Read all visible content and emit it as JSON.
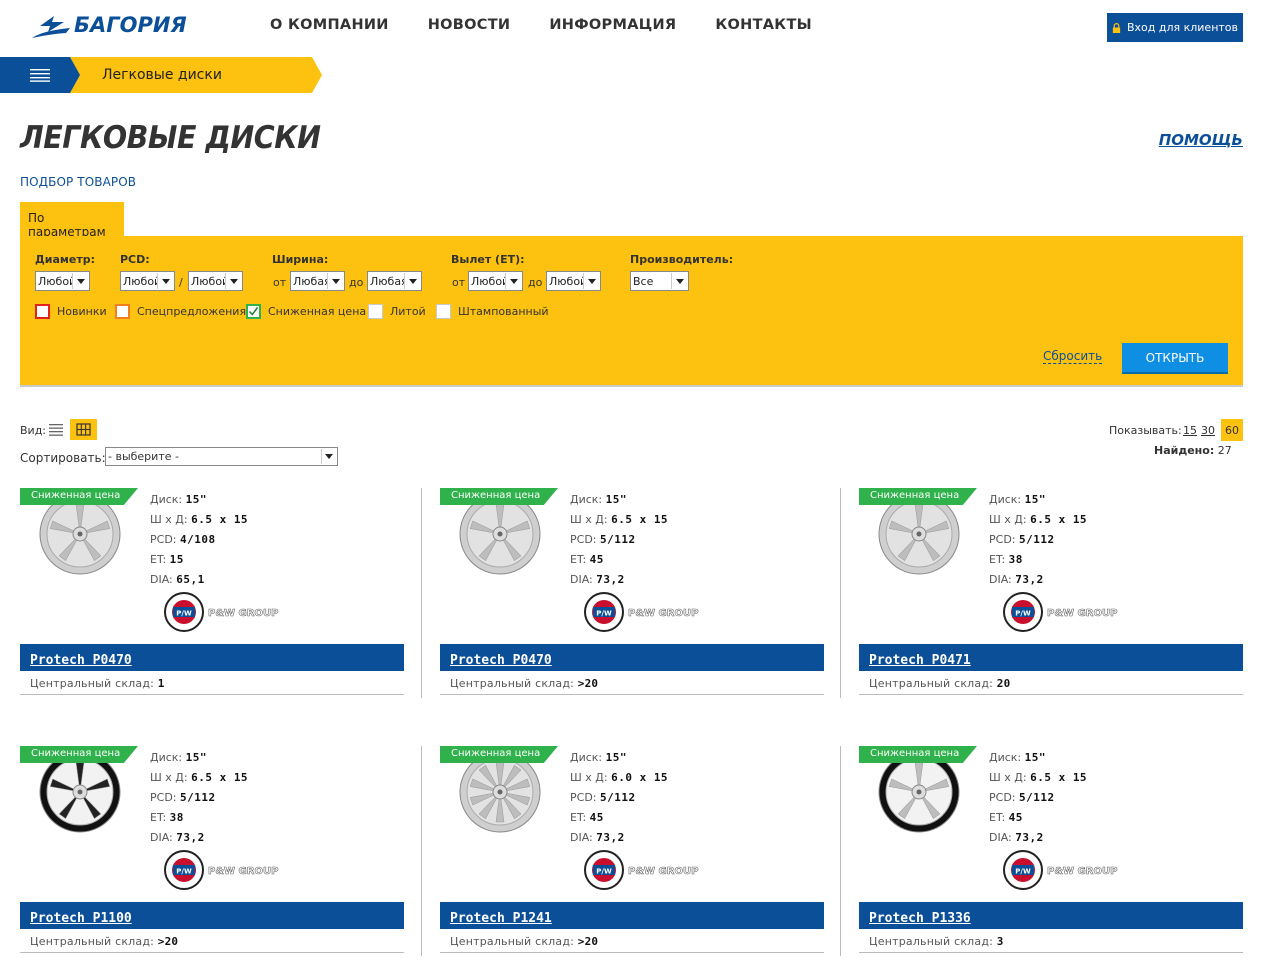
{
  "header": {
    "logo_text": "БАГОРИЯ",
    "nav": [
      "О КОМПАНИИ",
      "НОВОСТИ",
      "ИНФОРМАЦИЯ",
      "КОНТАКТЫ"
    ],
    "login_label": "Вход для клиентов"
  },
  "breadcrumb": {
    "current": "Легковые диски"
  },
  "page": {
    "title": "ЛЕГКОВЫЕ ДИСКИ",
    "help": "ПОМОЩЬ",
    "subtitle": "ПОДБОР ТОВАРОВ"
  },
  "filter": {
    "tab_label": "По параметрам",
    "diameter_label": "Диаметр:",
    "diameter_value": "Любой",
    "pcd_label": "PCD:",
    "pcd_value1": "Любой",
    "pcd_sep": "/",
    "pcd_value2": "Любой",
    "width_label": "Ширина:",
    "from": "от",
    "to": "до",
    "width_from": "Любая",
    "width_to": "Любая",
    "et_label": "Вылет (ET):",
    "et_from": "Любой",
    "et_to": "Любой",
    "maker_label": "Производитель:",
    "maker_value": "Все",
    "checkboxes": [
      {
        "label": "Новинки",
        "checked": false
      },
      {
        "label": "Спецпредложения",
        "checked": false
      },
      {
        "label": "Сниженная цена",
        "checked": true
      },
      {
        "label": "Литой",
        "checked": false
      },
      {
        "label": "Штампованный",
        "checked": false
      }
    ],
    "reset": "Сбросить",
    "open": "ОТКРЫТЬ"
  },
  "controls": {
    "view_label": "Вид:",
    "sort_label": "Сортировать:",
    "sort_value": "- выберите -",
    "show_label": "Показывать:",
    "show_options": [
      "15",
      "30"
    ],
    "show_active": "60",
    "found_label": "Найдено:",
    "found_count": "27"
  },
  "product_labels": {
    "badge": "Сниженная цена",
    "disk": "Диск:",
    "size": "Ш х Д:",
    "pcd": "PCD:",
    "et": "ET:",
    "dia": "DIA:",
    "stock": "Центральный склад:",
    "brand_text": "P&W GROUP"
  },
  "products": [
    {
      "name": "Protech P0470",
      "disk": "15\"",
      "size": "6.5 x 15",
      "pcd": "4/108",
      "et": "15",
      "dia": "65,1",
      "stock": "1",
      "style": "silver"
    },
    {
      "name": "Protech P0470",
      "disk": "15\"",
      "size": "6.5 x 15",
      "pcd": "5/112",
      "et": "45",
      "dia": "73,2",
      "stock": ">20",
      "style": "silver"
    },
    {
      "name": "Protech P0471",
      "disk": "15\"",
      "size": "6.5 x 15",
      "pcd": "5/112",
      "et": "38",
      "dia": "73,2",
      "stock": "20",
      "style": "silver2"
    },
    {
      "name": "Protech P1100",
      "disk": "15\"",
      "size": "6.5 x 15",
      "pcd": "5/112",
      "et": "38",
      "dia": "73,2",
      "stock": ">20",
      "style": "black"
    },
    {
      "name": "Protech P1241",
      "disk": "15\"",
      "size": "6.0 x 15",
      "pcd": "5/112",
      "et": "45",
      "dia": "73,2",
      "stock": ">20",
      "style": "mesh"
    },
    {
      "name": "Protech P1336",
      "disk": "15\"",
      "size": "6.5 x 15",
      "pcd": "5/112",
      "et": "45",
      "dia": "73,2",
      "stock": "3",
      "style": "blackspoke"
    }
  ],
  "colors": {
    "brand_blue": "#0c4f99",
    "accent_yellow": "#fdc10f",
    "badge_green": "#2fb14b",
    "button_blue": "#0f8fe3"
  }
}
